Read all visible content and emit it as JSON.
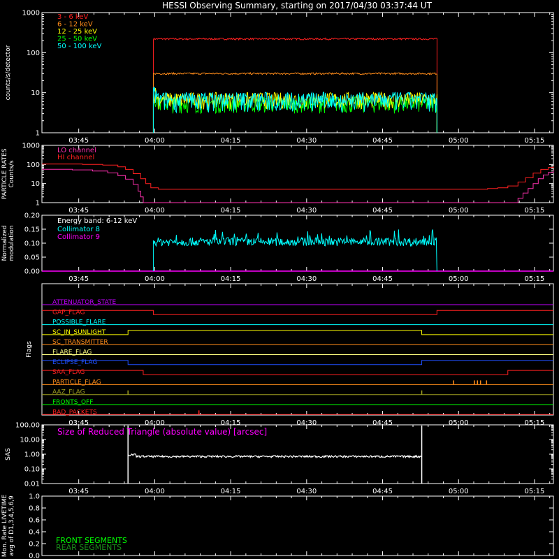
{
  "title": "HESSI Observing Summary, starting on 2017/04/30 03:37:44 UT",
  "time_axis": {
    "start_min": 0,
    "end_min": 101,
    "tick_minutes": [
      7.27,
      22.27,
      37.27,
      52.27,
      67.27,
      82.27,
      97.27
    ],
    "tick_labels": [
      "03:45",
      "04:00",
      "04:15",
      "04:30",
      "04:45",
      "05:00",
      "05:15"
    ]
  },
  "chart_data": [
    {
      "type": "line",
      "id": "count_rates",
      "ylabel": "counts/s/detector",
      "yscale": "log",
      "ylim": [
        1,
        1000
      ],
      "yticks": [
        "1",
        "10",
        "100",
        "1000"
      ],
      "legend_placement": "top-left",
      "segment": [
        22.0,
        78.0
      ],
      "series": [
        {
          "name": "3 - 6 keV",
          "color": "#ff2020",
          "level": 220
        },
        {
          "name": "6 - 12 keV",
          "color": "#ff8c1a",
          "level": 30
        },
        {
          "name": "12 - 25 keV",
          "color": "#ffff00",
          "level": 7
        },
        {
          "name": "25 - 50 keV",
          "color": "#00ff00",
          "level": 5.5
        },
        {
          "name": "50 - 100 keV",
          "color": "#00ffff",
          "level": 8
        }
      ]
    },
    {
      "type": "line",
      "id": "particle_rates",
      "ylabel_lines": [
        "PARTICLE RATES",
        "Counts/s"
      ],
      "yscale": "log",
      "ylim": [
        1,
        1000
      ],
      "yticks": [
        "1",
        "10",
        "100",
        "1000"
      ],
      "series": [
        {
          "name": "LO channel",
          "color": "#ff30b0",
          "points": [
            [
              0,
              56
            ],
            [
              6,
              52
            ],
            [
              10,
              45
            ],
            [
              13,
              36
            ],
            [
              15,
              26
            ],
            [
              16.5,
              17
            ],
            [
              18,
              9
            ],
            [
              19,
              4
            ],
            [
              19.5,
              2
            ],
            [
              20,
              1
            ],
            [
              93,
              1
            ],
            [
              94,
              1.7
            ],
            [
              95,
              3.2
            ],
            [
              96,
              5.5
            ],
            [
              97,
              10
            ],
            [
              98,
              18
            ],
            [
              99,
              28
            ],
            [
              100,
              38
            ],
            [
              101,
              48
            ]
          ]
        },
        {
          "name": "HI channel",
          "color": "#ff2020",
          "points": [
            [
              0,
              105
            ],
            [
              8,
              100
            ],
            [
              12,
              92
            ],
            [
              15,
              75
            ],
            [
              16.5,
              55
            ],
            [
              18,
              33
            ],
            [
              19.5,
              18
            ],
            [
              20.5,
              10
            ],
            [
              21.5,
              6
            ],
            [
              23,
              5
            ],
            [
              30,
              5
            ],
            [
              40,
              5
            ],
            [
              50,
              5
            ],
            [
              60,
              5
            ],
            [
              70,
              5
            ],
            [
              80,
              5
            ],
            [
              86,
              5
            ],
            [
              88,
              5.5
            ],
            [
              90,
              6
            ],
            [
              92,
              7.5
            ],
            [
              94,
              12
            ],
            [
              95.5,
              20
            ],
            [
              97,
              35
            ],
            [
              98.5,
              55
            ],
            [
              100,
              70
            ],
            [
              101,
              80
            ]
          ]
        }
      ]
    },
    {
      "type": "line",
      "id": "modulation",
      "ylabel_lines": [
        "Normalized",
        "modulation"
      ],
      "ylim": [
        0,
        0.2
      ],
      "yticks": [
        "0.00",
        "0.05",
        "0.10",
        "0.15",
        "0.20"
      ],
      "legend_header": "Energy band: 6-12 keV",
      "segment": [
        22.0,
        78.0
      ],
      "series": [
        {
          "name": "Collimator 8",
          "color": "#00ffff",
          "level": 0.105
        },
        {
          "name": "Collimator 9",
          "color": "#ff00ff",
          "level": 0.0
        }
      ]
    },
    {
      "type": "line",
      "id": "flags",
      "ylabel": "Flags",
      "flags": [
        {
          "name": "ATTENUATOR_STATE",
          "color": "#c000ff",
          "segments": [
            [
              0,
              101,
              0
            ]
          ]
        },
        {
          "name": "GAP_FLAG",
          "color": "#ff2020",
          "segments": [
            [
              0,
              22,
              1
            ],
            [
              22,
              78,
              0
            ],
            [
              78,
              101,
              1
            ]
          ]
        },
        {
          "name": "POSSIBLE_FLARE",
          "color": "#00ffff",
          "segments": [
            [
              0,
              101,
              0
            ]
          ]
        },
        {
          "name": "SC_IN_SUNLIGHT",
          "color": "#ffff00",
          "segments": [
            [
              0,
              17,
              0
            ],
            [
              17,
              75,
              1
            ],
            [
              75,
              101,
              0
            ]
          ]
        },
        {
          "name": "SC_TRANSMITTER",
          "color": "#ff8c1a",
          "segments": [
            [
              0,
              101,
              0
            ]
          ]
        },
        {
          "name": "FLARE_FLAG",
          "color": "#ffff80",
          "segments": [
            [
              0,
              101,
              0
            ]
          ]
        },
        {
          "name": "ECLIPSE_FLAG",
          "color": "#2050ff",
          "segments": [
            [
              0,
              17,
              1
            ],
            [
              17,
              75,
              0
            ],
            [
              75,
              101,
              1
            ]
          ]
        },
        {
          "name": "SAA_FLAG",
          "color": "#ff2020",
          "segments": [
            [
              0,
              20,
              1
            ],
            [
              20,
              92,
              0
            ],
            [
              92,
              101,
              1
            ]
          ]
        },
        {
          "name": "PARTICLE_FLAG",
          "color": "#ff8c1a",
          "spikes": [
            81.3,
            85.4,
            86.0,
            86.6,
            87.8
          ]
        },
        {
          "name": "AAZ_FLAG",
          "color": "#a0a020",
          "spikes": [
            17.0,
            75.0
          ]
        },
        {
          "name": "FRONTS_OFF",
          "color": "#00ff00",
          "segments": [
            [
              0,
              101,
              0
            ]
          ]
        },
        {
          "name": "BAD_PACKETS",
          "color": "#ff2020",
          "spikes": [
            31.0
          ]
        }
      ]
    },
    {
      "type": "line",
      "id": "sas",
      "ylabel": "SAS",
      "yscale": "log",
      "ylim": [
        0.01,
        100
      ],
      "yticks": [
        "0.01",
        "0.10",
        "1.00",
        "10.00",
        "100.00"
      ],
      "annotation": "Size of Reduced Triangle (absolute value) [arcsec]",
      "annotation_color": "#ff00ff",
      "segment": [
        17.0,
        75.0
      ],
      "level": 0.7
    },
    {
      "type": "line",
      "id": "livetime",
      "ylabel_lines": [
        "Mon. Rate LIVETIME",
        "avg of D1,3,4,5,6,9"
      ],
      "ylim": [
        0,
        1
      ],
      "yticks": [
        "0.0",
        "0.2",
        "0.4",
        "0.6",
        "0.8",
        "1.0"
      ],
      "legend": [
        {
          "name": "FRONT SEGMENTS",
          "color": "#00ff00"
        },
        {
          "name": "REAR SEGMENTS",
          "color": "#1a8c1a"
        }
      ]
    }
  ]
}
